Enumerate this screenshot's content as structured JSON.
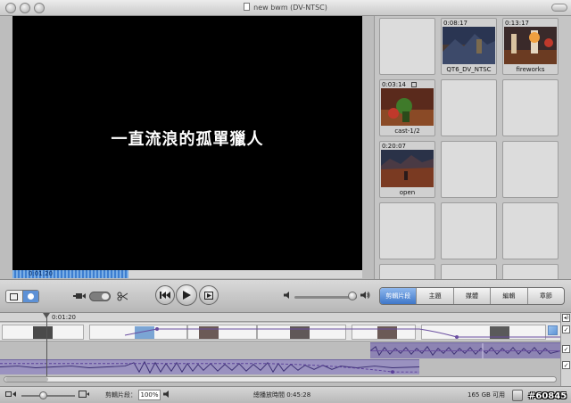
{
  "window": {
    "title": "new bwm (DV-NTSC)"
  },
  "viewer": {
    "subtitle": "一直流浪的孤單獵人",
    "time": "0:01:20"
  },
  "clips": [
    {
      "duration": "",
      "name": "",
      "thumb": ""
    },
    {
      "duration": "0:08:17",
      "name": "QT6_DV_NTSC",
      "thumb": "dusk-landscape"
    },
    {
      "duration": "0:13:17",
      "name": "fireworks",
      "thumb": "fireworks"
    },
    {
      "duration": "0:03:14",
      "name": "cast-1/2",
      "thumb": "character",
      "locked": true
    },
    {
      "duration": "",
      "name": "",
      "thumb": ""
    },
    {
      "duration": "",
      "name": "",
      "thumb": ""
    },
    {
      "duration": "0:20:07",
      "name": "open",
      "thumb": "red-canyon"
    }
  ],
  "pane_tabs": [
    "剪輯片段",
    "主題",
    "媒體",
    "編輯",
    "章節"
  ],
  "timeline": {
    "playhead_time": "0:01:20"
  },
  "statusbar": {
    "clip_label": "剪輯片段：",
    "zoom_percent": "100%",
    "total_duration": "總播放時間 0:45:28",
    "free_space": "165 GB 可用",
    "badge": "#60845"
  },
  "icons": [
    "document-icon",
    "camera-mode-icon",
    "edit-mode-icon",
    "camera-icon",
    "scissors-icon",
    "rewind-icon",
    "play-icon",
    "fullscreen-play-icon",
    "volume-low-icon",
    "volume-high-icon",
    "trash-icon"
  ],
  "colors": {
    "accent": "#3f77c9",
    "audio": "#8d84b3",
    "viewer_bg": "#000000"
  }
}
